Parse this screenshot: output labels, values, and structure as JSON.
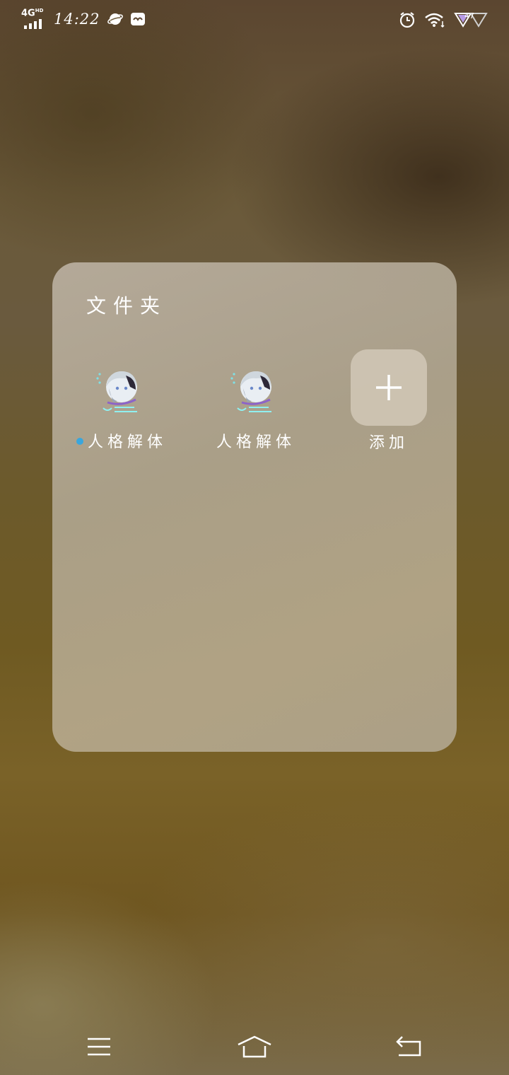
{
  "status_bar": {
    "network_type": "4G",
    "network_sub": "HD",
    "time": "14:22",
    "left_icons": [
      "planet-icon",
      "message-icon"
    ],
    "right_icons": [
      "alarm-icon",
      "wifi-icon",
      "vpn-triangle-icon"
    ],
    "battery_level": "47"
  },
  "folder": {
    "title": "文件夹",
    "apps": [
      {
        "label": "人格解体",
        "icon": "anime-avatar-icon",
        "has_notification_dot": true
      },
      {
        "label": "人格解体",
        "icon": "anime-avatar-icon",
        "has_notification_dot": false
      }
    ],
    "add_label": "添加"
  },
  "nav_bar": {
    "buttons": [
      "menu-icon",
      "home-icon",
      "back-icon"
    ]
  },
  "colors": {
    "notification_dot": "#3aa6dc",
    "panel": "#b8ad98"
  }
}
